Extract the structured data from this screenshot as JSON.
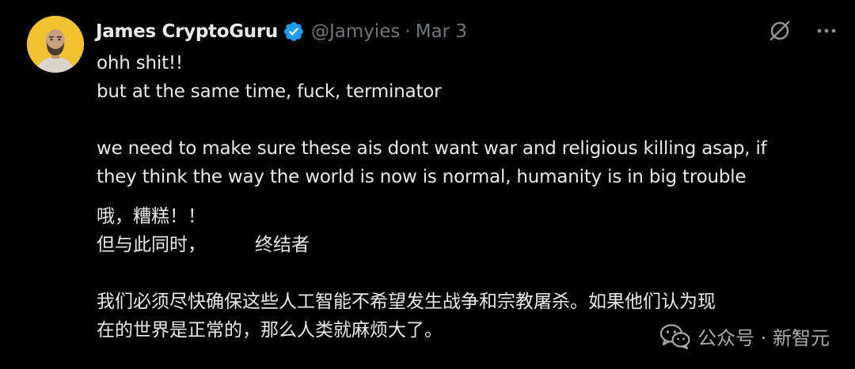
{
  "tweet": {
    "author": {
      "display_name": "James CryptoGuru",
      "handle": "@Jamyies",
      "verified": true,
      "avatar_icon": "person-avatar"
    },
    "separator": "·",
    "date": "Mar 3",
    "actions": {
      "grok_icon": "grok-slash-circle-icon",
      "more_icon": "more-dots-icon"
    },
    "text_en": {
      "line1": "ohh shit!!",
      "line2": "but at the same time, fuck, terminator",
      "line3": "we need to make sure these ais dont want war and religious killing asap, if",
      "line4": "they think the way the world is now is normal, humanity is in big trouble"
    },
    "text_zh": {
      "line1": "哦，糟糕！！",
      "line2a": "但与此同时，",
      "line2b": "终结者",
      "line3": "我们必须尽快确保这些人工智能不希望发生战争和宗教屠杀。如果他们认为现",
      "line4": "在的世界是正常的，那么人类就麻烦大了。"
    }
  },
  "watermark": {
    "icon": "wechat-icon",
    "text": "公众号 · 新智元"
  },
  "colors": {
    "background": "#000000",
    "primary_text": "#e7e9ea",
    "secondary_text": "#71767b",
    "verified_blue": "#1d9bf0",
    "avatar_bg": "#f1c232"
  }
}
